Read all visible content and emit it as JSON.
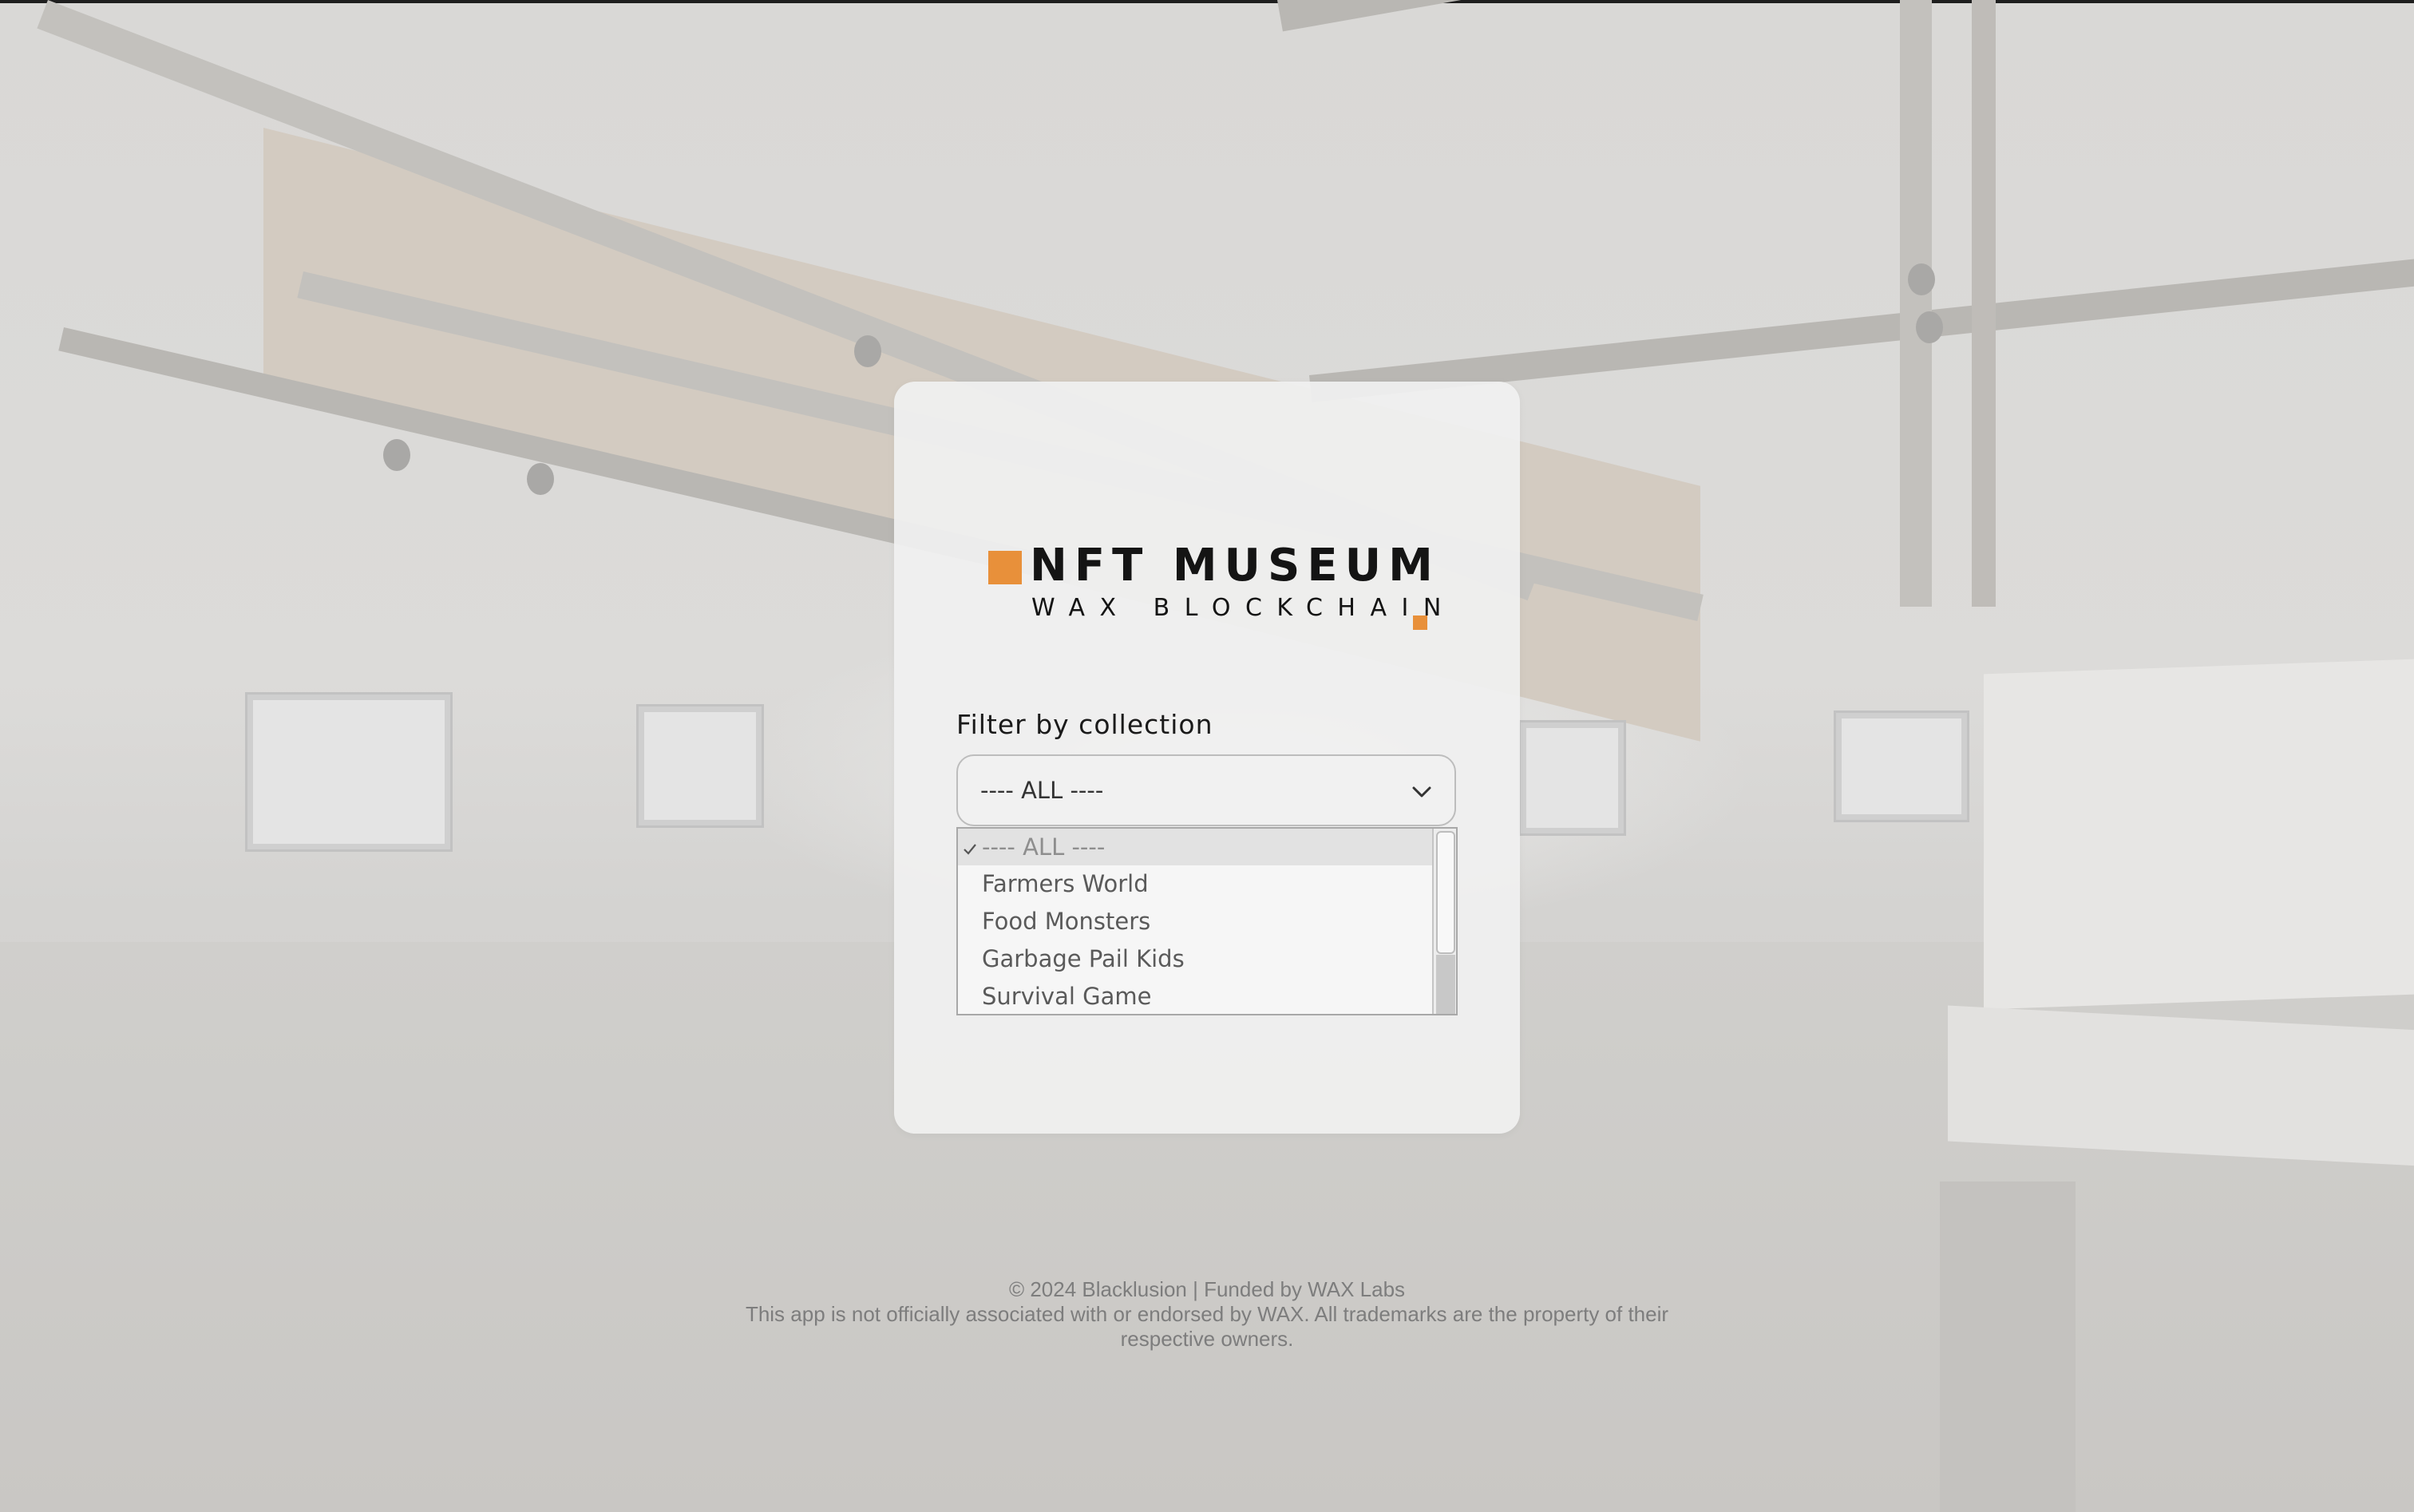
{
  "logo": {
    "title": "NFT MUSEUM",
    "subtitle": "WAX BLOCKCHAIN",
    "accent_color": "#e8903a"
  },
  "filter": {
    "label": "Filter by collection",
    "selected_value": "---- ALL ----",
    "options": [
      {
        "label": "---- ALL ----",
        "selected": true
      },
      {
        "label": "Farmers World",
        "selected": false
      },
      {
        "label": "Food Monsters",
        "selected": false
      },
      {
        "label": "Garbage Pail Kids",
        "selected": false
      },
      {
        "label": "Survival Game",
        "selected": false
      }
    ]
  },
  "submit": {
    "color": "#e8873a"
  },
  "footer": {
    "copyright": "© 2024 Blacklusion | Funded by WAX Labs",
    "disclaimer": "This app is not officially associated with or endorsed by WAX. All trademarks are the property of their respective owners."
  },
  "icons": {
    "dropdown": "chevron-down-icon",
    "selected": "checkmark-icon"
  }
}
